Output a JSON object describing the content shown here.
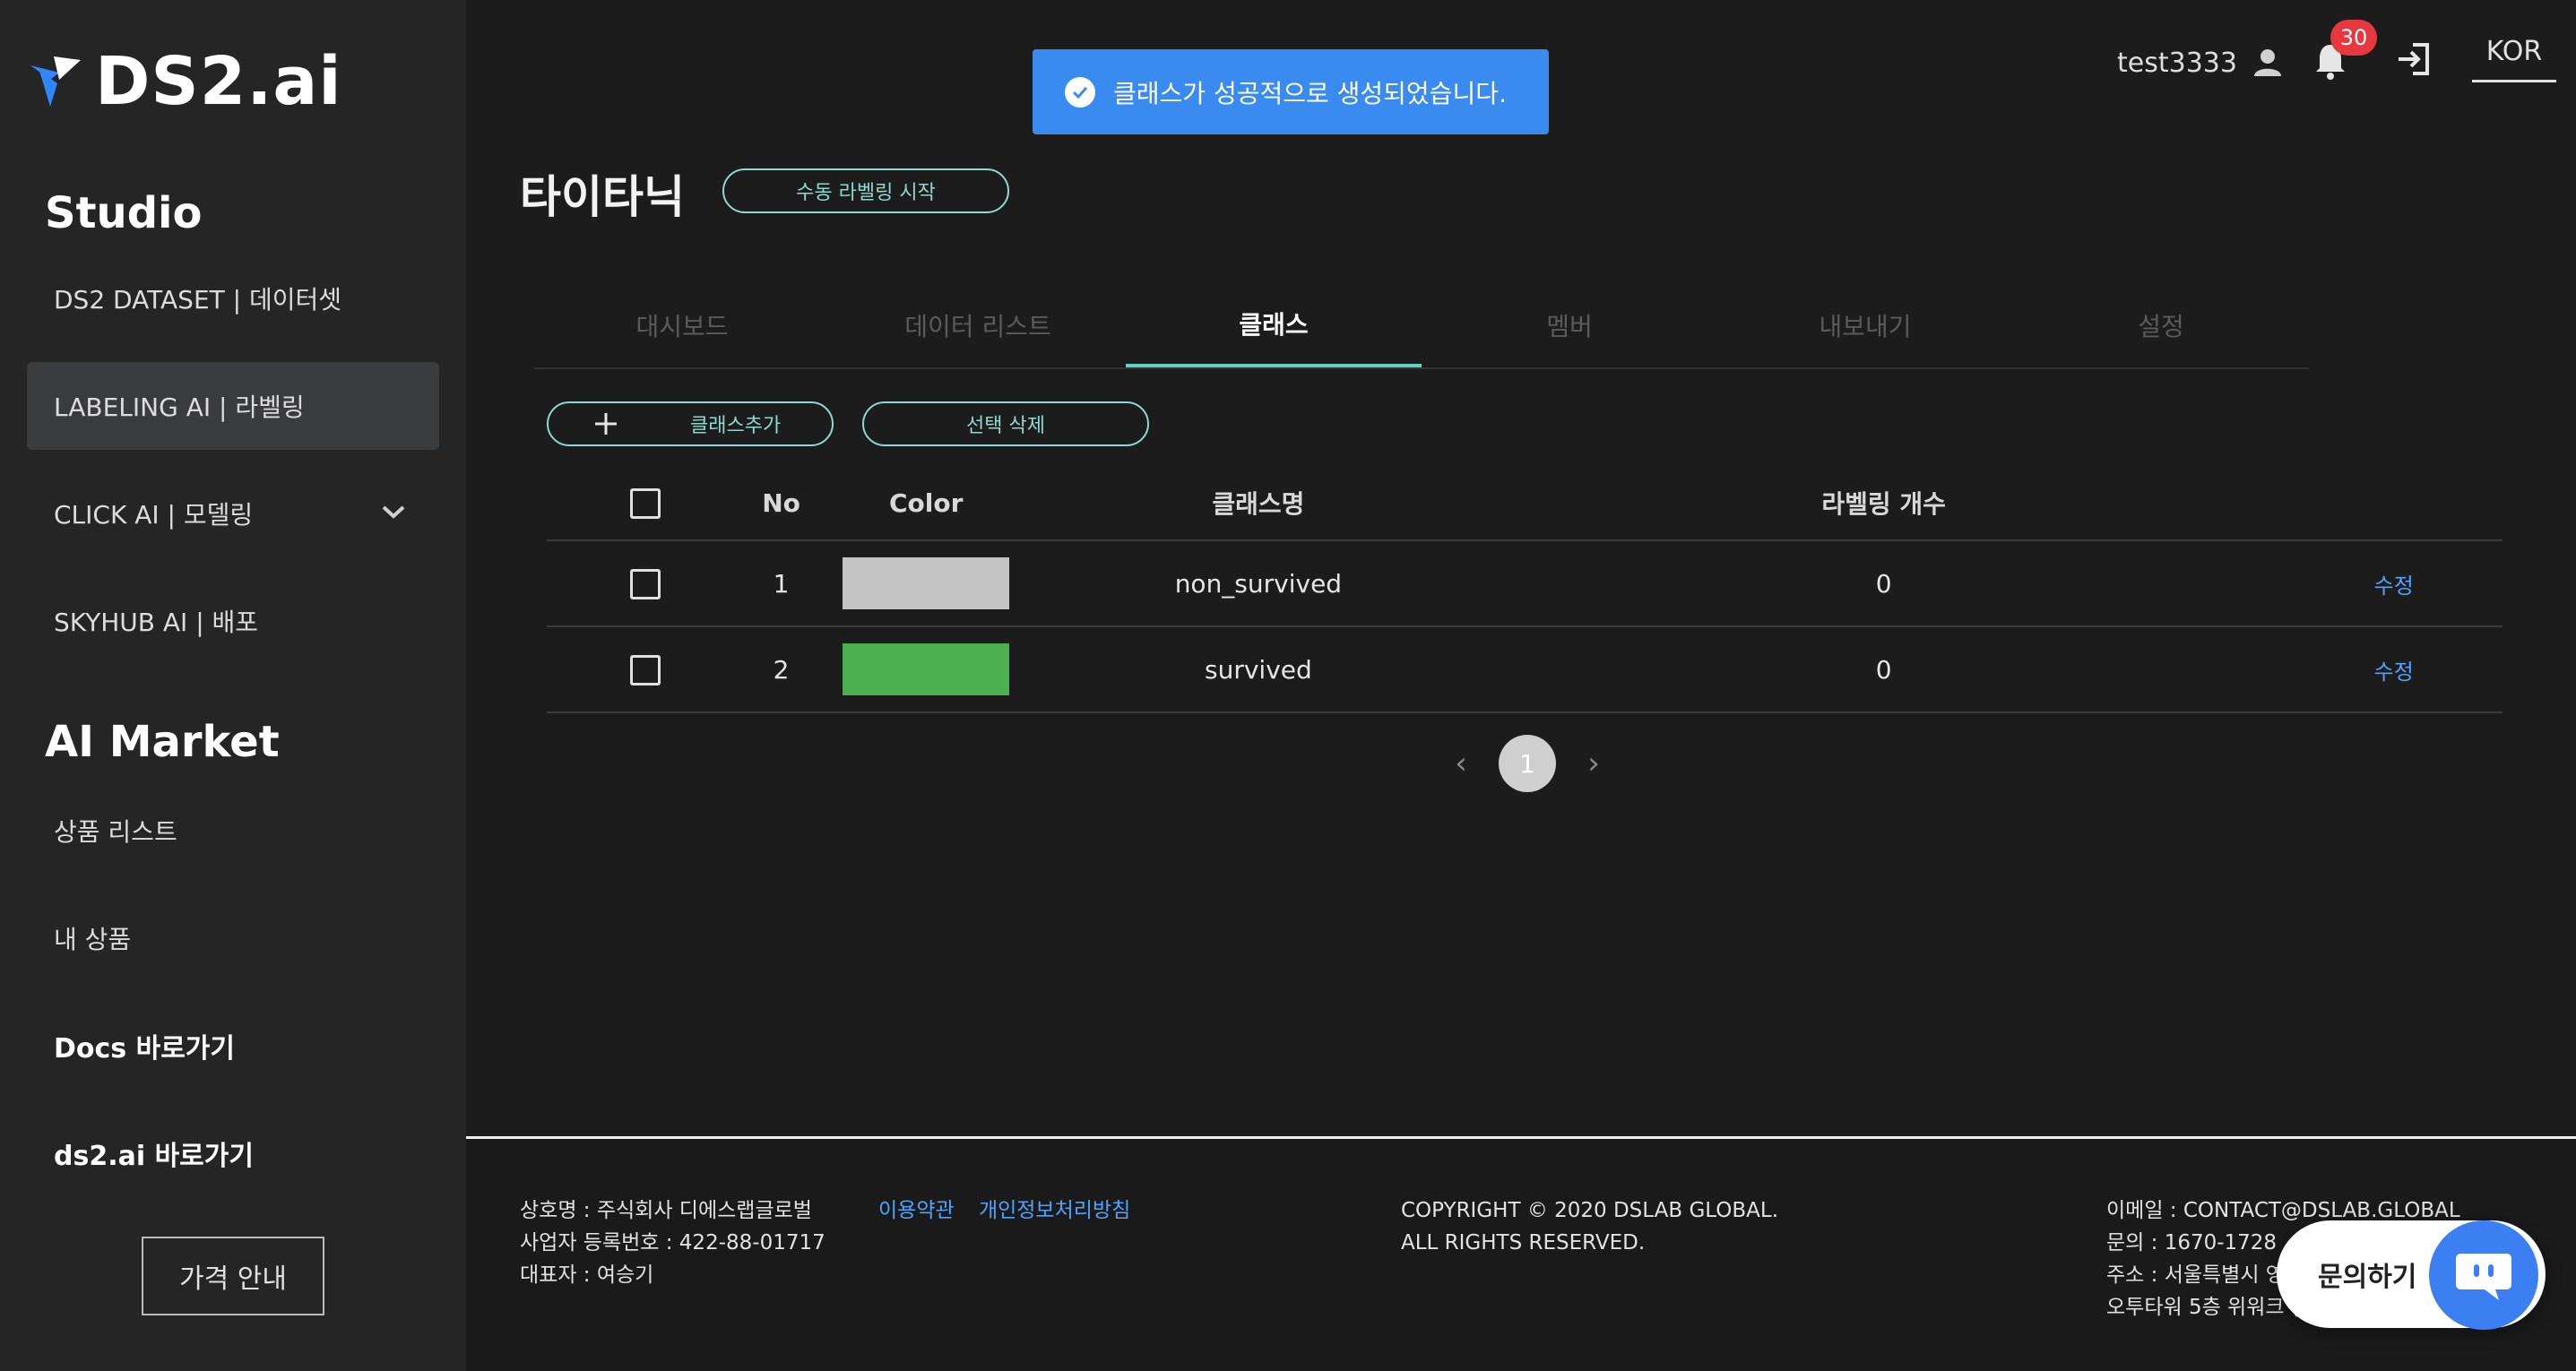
{
  "app": {
    "logo_text": "DS2.ai"
  },
  "sidebar": {
    "studio_title": "Studio",
    "items": [
      {
        "label": "DS2 DATASET | 데이터셋"
      },
      {
        "label": "LABELING AI | 라벨링"
      },
      {
        "label": "CLICK AI | 모델링"
      },
      {
        "label": "SKYHUB AI | 배포"
      }
    ],
    "market_title": "AI Market",
    "market_items": [
      {
        "label": "상품 리스트"
      },
      {
        "label": "내 상품"
      },
      {
        "label": "Docs 바로가기"
      },
      {
        "label": "ds2.ai 바로가기"
      }
    ],
    "price_button": "가격 안내"
  },
  "toast": {
    "message": "클래스가 성공적으로 생성되었습니다."
  },
  "header": {
    "username": "test3333",
    "notification_count": "30",
    "language": "KOR"
  },
  "page": {
    "title": "타이타닉",
    "manual_label_button": "수동 라벨링 시작"
  },
  "tabs": [
    {
      "label": "대시보드"
    },
    {
      "label": "데이터 리스트"
    },
    {
      "label": "클래스"
    },
    {
      "label": "멤버"
    },
    {
      "label": "내보내기"
    },
    {
      "label": "설정"
    }
  ],
  "actions": {
    "add_class": "클래스추가",
    "delete_selected": "선택 삭제"
  },
  "table": {
    "columns": {
      "no": "No",
      "color": "Color",
      "class_name": "클래스명",
      "label_count": "라벨링 개수"
    },
    "rows": [
      {
        "no": "1",
        "color": "#c4c4c4",
        "name": "non_survived",
        "count": "0",
        "edit": "수정"
      },
      {
        "no": "2",
        "color": "#4caf50",
        "name": "survived",
        "count": "0",
        "edit": "수정"
      }
    ]
  },
  "pagination": {
    "current": "1"
  },
  "footer": {
    "company": "상호명 : 주식회사 디에스랩글로벌",
    "business_no": "사업자 등록번호 : 422-88-01717",
    "ceo": "대표자 : 여승기",
    "terms": "이용약관",
    "privacy": "개인정보처리방침",
    "copyright_1": "COPYRIGHT © 2020 DSLAB GLOBAL.",
    "copyright_2": "ALL RIGHTS RESERVED.",
    "email": "이메일 : CONTACT@DSLAB.GLOBAL",
    "phone": "문의 : 1670-1728",
    "address_1": "주소 : 서울특별시 영",
    "address_2": "오투타워 5층 위워크 ("
  },
  "chat": {
    "label": "문의하기"
  },
  "colors": {
    "accent": "#5fd2c4",
    "toast": "#3a8bf0",
    "link": "#4ea3ff",
    "badge": "#e5393f"
  }
}
